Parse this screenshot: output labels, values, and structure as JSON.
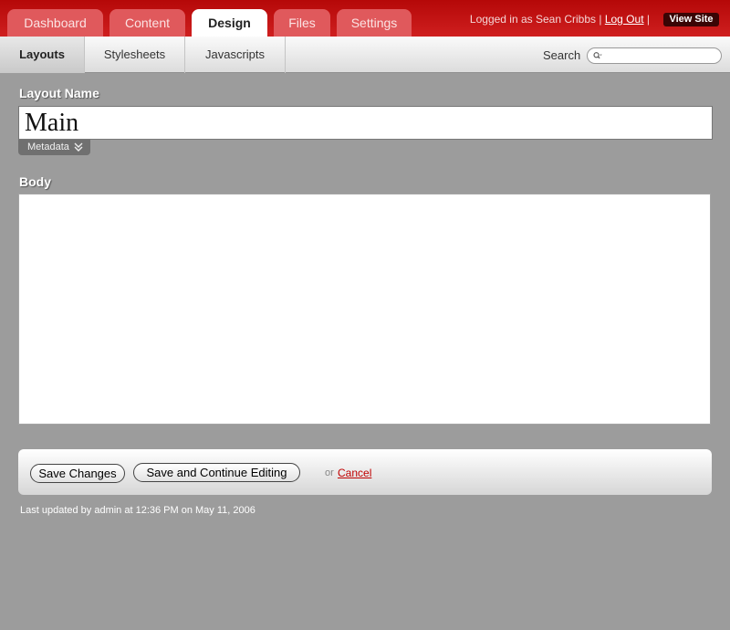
{
  "header": {
    "tabs": [
      {
        "label": "Dashboard"
      },
      {
        "label": "Content"
      },
      {
        "label": "Design",
        "active": true
      },
      {
        "label": "Files"
      },
      {
        "label": "Settings"
      }
    ],
    "user": {
      "logged_in_text": "Logged in as Sean Cribbs",
      "separator": "|",
      "logout_label": "Log Out",
      "view_site_label": "View Site"
    }
  },
  "subnav": {
    "tabs": [
      {
        "label": "Layouts",
        "active": true
      },
      {
        "label": "Stylesheets"
      },
      {
        "label": "Javascripts"
      }
    ],
    "search": {
      "label": "Search",
      "value": "",
      "icon": "search-icon"
    }
  },
  "form": {
    "name_label": "Layout Name",
    "name_value": "Main",
    "metadata_label": "Metadata",
    "body_label": "Body",
    "body_value": ""
  },
  "actions": {
    "save_label": "Save Changes",
    "save_continue_label": "Save and Continue Editing",
    "or_text": "or",
    "cancel_label": "Cancel"
  },
  "footer": {
    "updated_text": "Last updated by admin at 12:36 PM on May 11, 2006"
  },
  "colors": {
    "header_red": "#b50808",
    "inactive_tab": "#e0595c",
    "page_background": "#9c9c9c",
    "cancel_link": "#c00000"
  }
}
